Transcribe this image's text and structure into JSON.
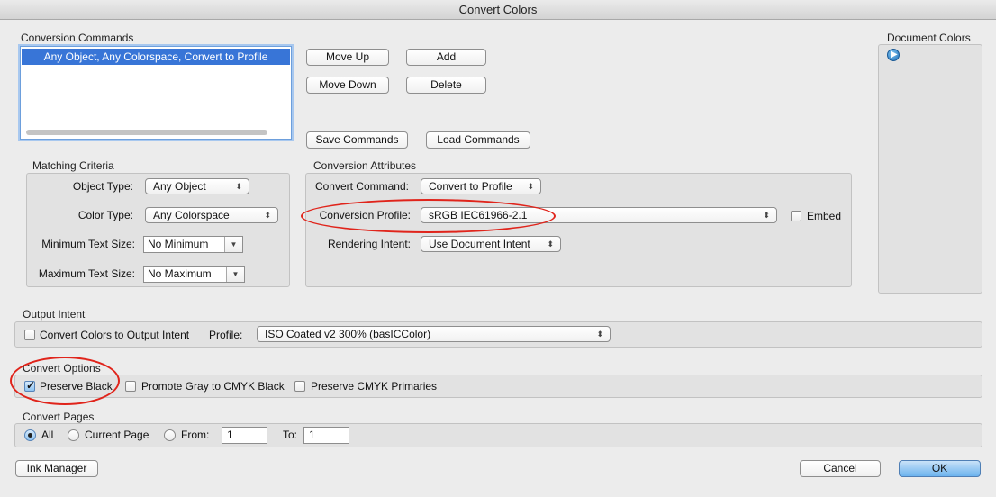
{
  "window": {
    "title": "Convert Colors"
  },
  "conversion_commands": {
    "label": "Conversion Commands",
    "items": [
      "Any Object, Any Colorspace, Convert to Profile"
    ],
    "buttons": {
      "move_up": "Move Up",
      "add": "Add",
      "move_down": "Move Down",
      "delete": "Delete",
      "save": "Save Commands",
      "load": "Load Commands"
    }
  },
  "matching_criteria": {
    "label": "Matching Criteria",
    "object_type": {
      "label": "Object Type:",
      "value": "Any Object"
    },
    "color_type": {
      "label": "Color Type:",
      "value": "Any Colorspace"
    },
    "min_text_size": {
      "label": "Minimum Text Size:",
      "value": "No Minimum"
    },
    "max_text_size": {
      "label": "Maximum Text Size:",
      "value": "No Maximum"
    }
  },
  "conversion_attributes": {
    "label": "Conversion Attributes",
    "convert_command": {
      "label": "Convert Command:",
      "value": "Convert to Profile"
    },
    "conversion_profile": {
      "label": "Conversion Profile:",
      "value": "sRGB IEC61966-2.1"
    },
    "embed": {
      "label": "Embed",
      "checked": false
    },
    "rendering_intent": {
      "label": "Rendering Intent:",
      "value": "Use Document Intent"
    }
  },
  "document_colors": {
    "label": "Document Colors"
  },
  "output_intent": {
    "label": "Output Intent",
    "convert_checkbox": {
      "label": "Convert Colors to Output Intent",
      "checked": false
    },
    "profile": {
      "label": "Profile:",
      "value": "ISO Coated v2 300% (basICColor)"
    }
  },
  "convert_options": {
    "label": "Convert Options",
    "preserve_black": {
      "label": "Preserve Black",
      "checked": true
    },
    "promote_gray": {
      "label": "Promote Gray to CMYK Black",
      "checked": false
    },
    "preserve_cmyk": {
      "label": "Preserve CMYK Primaries",
      "checked": false
    }
  },
  "convert_pages": {
    "label": "Convert Pages",
    "all": {
      "label": "All",
      "selected": true
    },
    "current_page": {
      "label": "Current Page",
      "selected": false
    },
    "from": {
      "label": "From:",
      "value": "1",
      "selected": false
    },
    "to": {
      "label": "To:",
      "value": "1"
    }
  },
  "footer": {
    "ink_manager": "Ink Manager",
    "cancel": "Cancel",
    "ok": "OK"
  },
  "colors": {
    "selection": "#3875d7",
    "annotation_ring": "#e0241b",
    "default_button": "#6cb3ee"
  }
}
